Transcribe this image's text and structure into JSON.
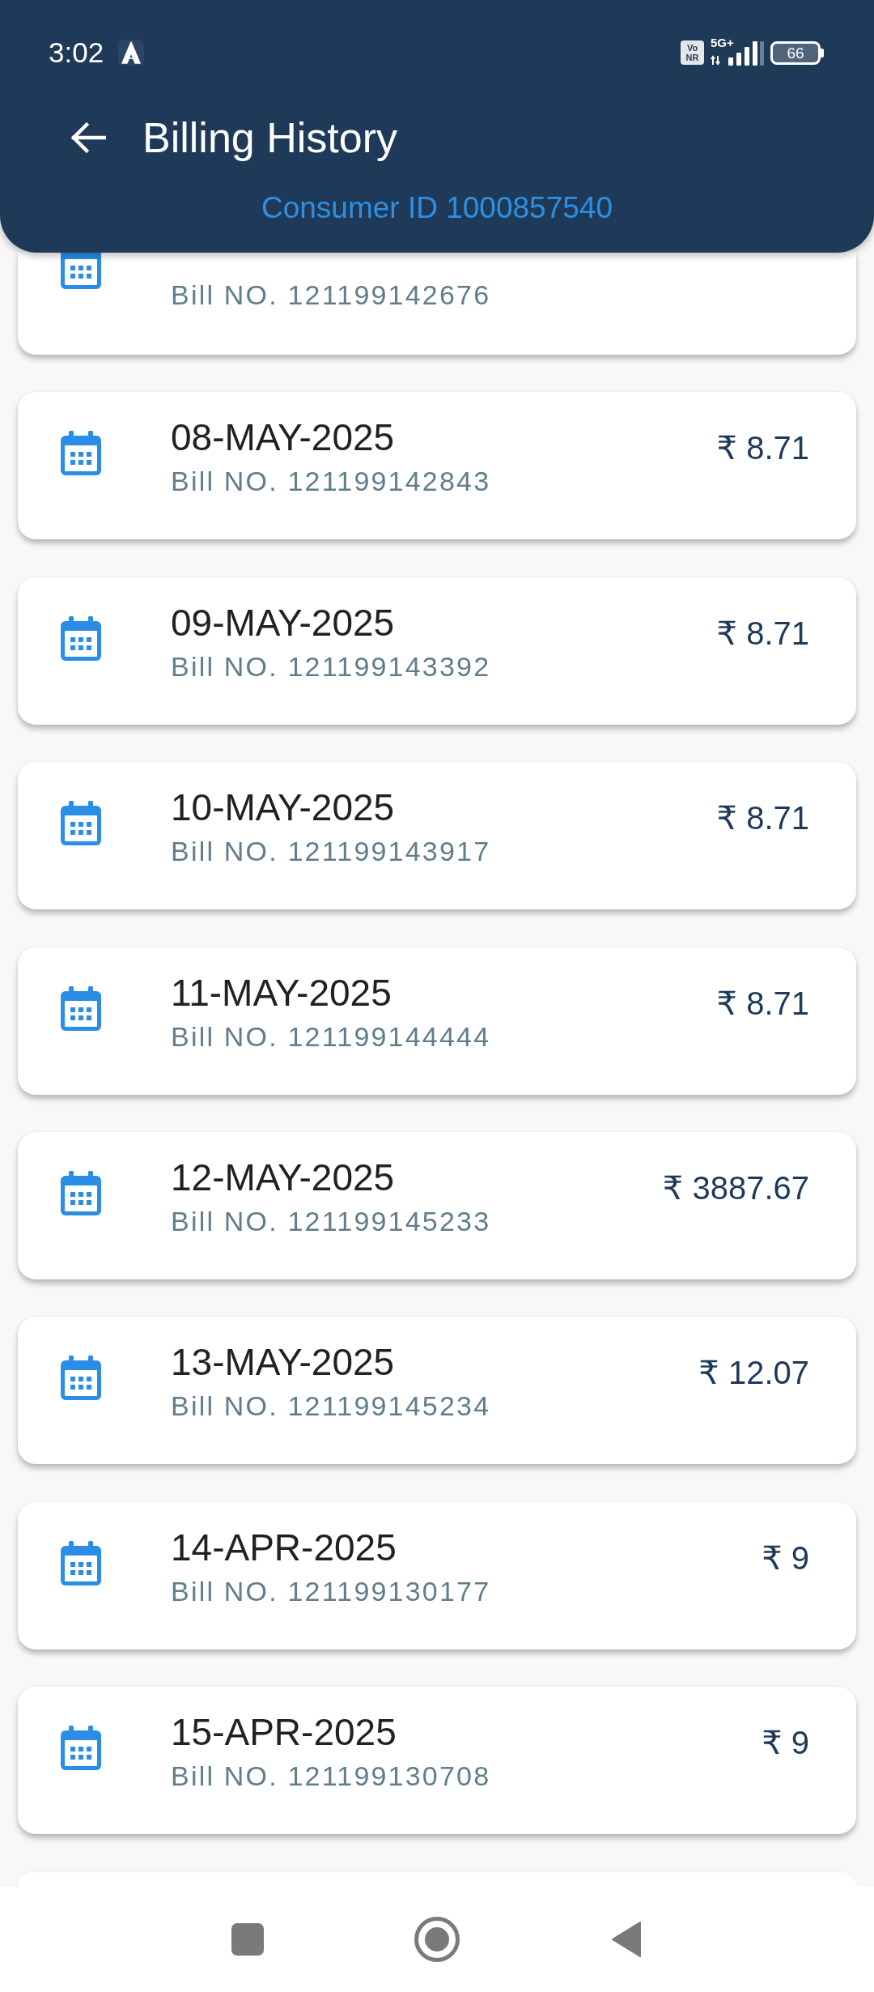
{
  "status_bar": {
    "time": "3:02",
    "call_badge": [
      "Vo",
      "NR"
    ],
    "network": "5G+",
    "battery": "66"
  },
  "header": {
    "title": "Billing History",
    "subtitle": "Consumer ID 1000857540"
  },
  "bills": [
    {
      "kind": "partial",
      "bill_no": "Bill NO. 121199142676"
    },
    {
      "kind": "full",
      "date": "08-MAY-2025",
      "bill_no": "Bill NO. 121199142843",
      "amount": "₹ 8.71"
    },
    {
      "kind": "full",
      "date": "09-MAY-2025",
      "bill_no": "Bill NO. 121199143392",
      "amount": "₹ 8.71"
    },
    {
      "kind": "full",
      "date": "10-MAY-2025",
      "bill_no": "Bill NO. 121199143917",
      "amount": "₹ 8.71"
    },
    {
      "kind": "full",
      "date": "11-MAY-2025",
      "bill_no": "Bill NO. 121199144444",
      "amount": "₹ 8.71"
    },
    {
      "kind": "full",
      "date": "12-MAY-2025",
      "bill_no": "Bill NO. 121199145233",
      "amount": "₹ 3887.67"
    },
    {
      "kind": "full",
      "date": "13-MAY-2025",
      "bill_no": "Bill NO. 121199145234",
      "amount": "₹ 12.07"
    },
    {
      "kind": "full",
      "date": "14-APR-2025",
      "bill_no": "Bill NO. 121199130177",
      "amount": "₹ 9"
    },
    {
      "kind": "full",
      "date": "15-APR-2025",
      "bill_no": "Bill NO. 121199130708",
      "amount": "₹ 9"
    }
  ]
}
